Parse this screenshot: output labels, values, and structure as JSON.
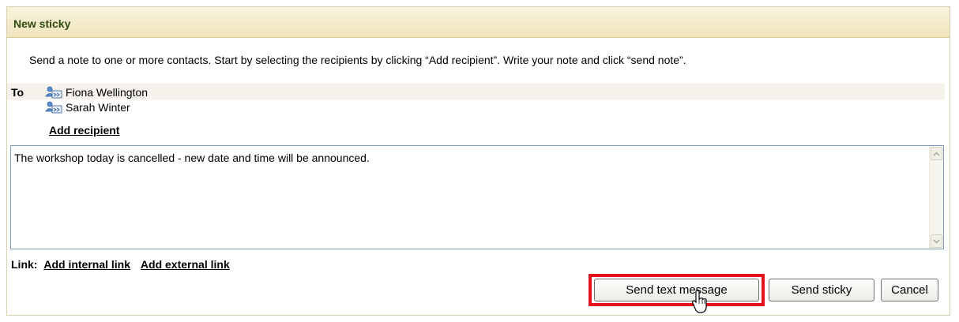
{
  "panel": {
    "title": "New sticky"
  },
  "intro_text": "Send a note to one or more contacts. Start by selecting the recipients by clicking “Add recipient”. Write your note and click “send note”.",
  "to": {
    "label": "To",
    "recipients": [
      {
        "name": "Fiona Wellington",
        "icon": "contact-icon"
      },
      {
        "name": "Sarah Winter",
        "icon": "contact-icon"
      }
    ],
    "add_recipient_label": "Add recipient"
  },
  "note": {
    "value": "The workshop today is cancelled - new date and time will be announced."
  },
  "links": {
    "label": "Link:",
    "internal_label": "Add internal link",
    "external_label": "Add external link"
  },
  "buttons": {
    "send_text_message": "Send text message",
    "send_sticky": "Send sticky",
    "cancel": "Cancel"
  },
  "colors": {
    "header_text": "#2f4a10",
    "highlight": "#e8101a",
    "header_bg": "#efe4bd"
  }
}
